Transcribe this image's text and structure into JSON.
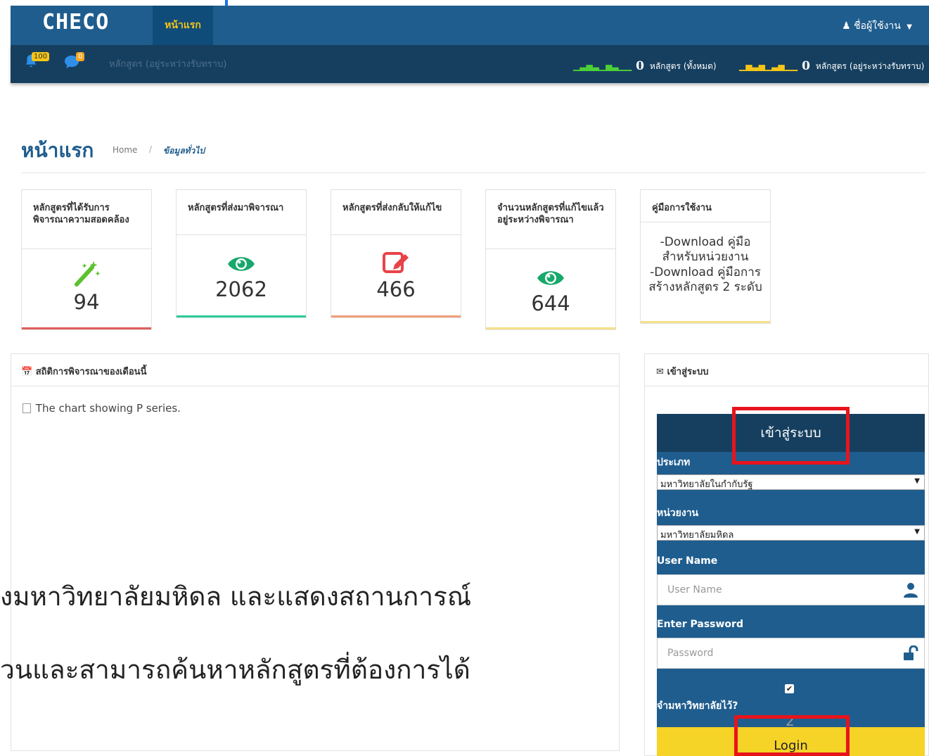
{
  "header": {
    "logo": "CHECO",
    "nav_active": "หน้าแรก",
    "user_menu": "ชื่อผู้ใช้งาน"
  },
  "subbar": {
    "bell_count": "100",
    "chat_count": "0",
    "faded_label": "หลักสูตร (อยู่ระหว่างรับทราบ)",
    "stat_all_value": "0",
    "stat_all_label": "หลักสูตร (ทั้งหมด)",
    "stat_pending_value": "0",
    "stat_pending_label": "หลักสูตร (อยู่ระหว่างรับทราบ)"
  },
  "page": {
    "title": "หน้าแรก",
    "breadcrumb_home": "Home",
    "breadcrumb_sep": "/",
    "breadcrumb_current": "ข้อมูลทั่วไป"
  },
  "cards": [
    {
      "title": "หลักสูตรที่ได้รับการพิจารณาความสอดคล้อง",
      "value": "94",
      "icon": "magic-wand-icon",
      "accent": "#e05d5d"
    },
    {
      "title": "หลักสูตรที่ส่งมาพิจารณา",
      "value": "2062",
      "icon": "eye-icon",
      "accent": "#2ecc9a"
    },
    {
      "title": "หลักสูตรที่ส่งกลับให้แก้ไข",
      "value": "466",
      "icon": "edit-icon",
      "accent": "#f0a07a"
    },
    {
      "title": "จำนวนหลักสูตรที่แก้ไขแล้วอยู่ระหว่างพิจารณา",
      "value": "644",
      "icon": "eye-icon",
      "accent": "#f5e08a"
    }
  ],
  "manual": {
    "title": "คู่มือการใช้งาน",
    "line1": "-Download คู่มือสำหรับหน่วยงาน",
    "line2": "-Download คู่มือการสร้างหลักสูตร 2 ระดับ"
  },
  "chart_panel": {
    "title": "สถิติการพิจารณาของเดือนนี้",
    "broken_image_alt": "The chart showing P series.",
    "overlay_line1": "งมหาวิทยาลัยมหิดล และแสดงสถานการณ์",
    "overlay_line2": "วนและสามารถค้นหาหลักสูตรที่ต้องการได้"
  },
  "login_panel": {
    "title": "เข้าสู่ระบบ",
    "box_title": "เข้าสู่ระบบ",
    "type_label": "ประเภท",
    "type_value": "มหาวิทยาลัยในกำกับรัฐ",
    "unit_label": "หน่วยงาน",
    "unit_value": "มหาวิทยาลัยมหิดล",
    "username_label": "User Name",
    "username_placeholder": "User Name",
    "password_label": "Enter Password",
    "password_placeholder": "Password",
    "remember_label": "จำมหาวิทยาลัยไว้?",
    "marker_2": "2",
    "login_button": "Login"
  },
  "colors": {
    "primary": "#1f5d8e",
    "dark": "#163f5f",
    "accent_yellow": "#f5d327",
    "highlight_red": "#e8141c"
  }
}
